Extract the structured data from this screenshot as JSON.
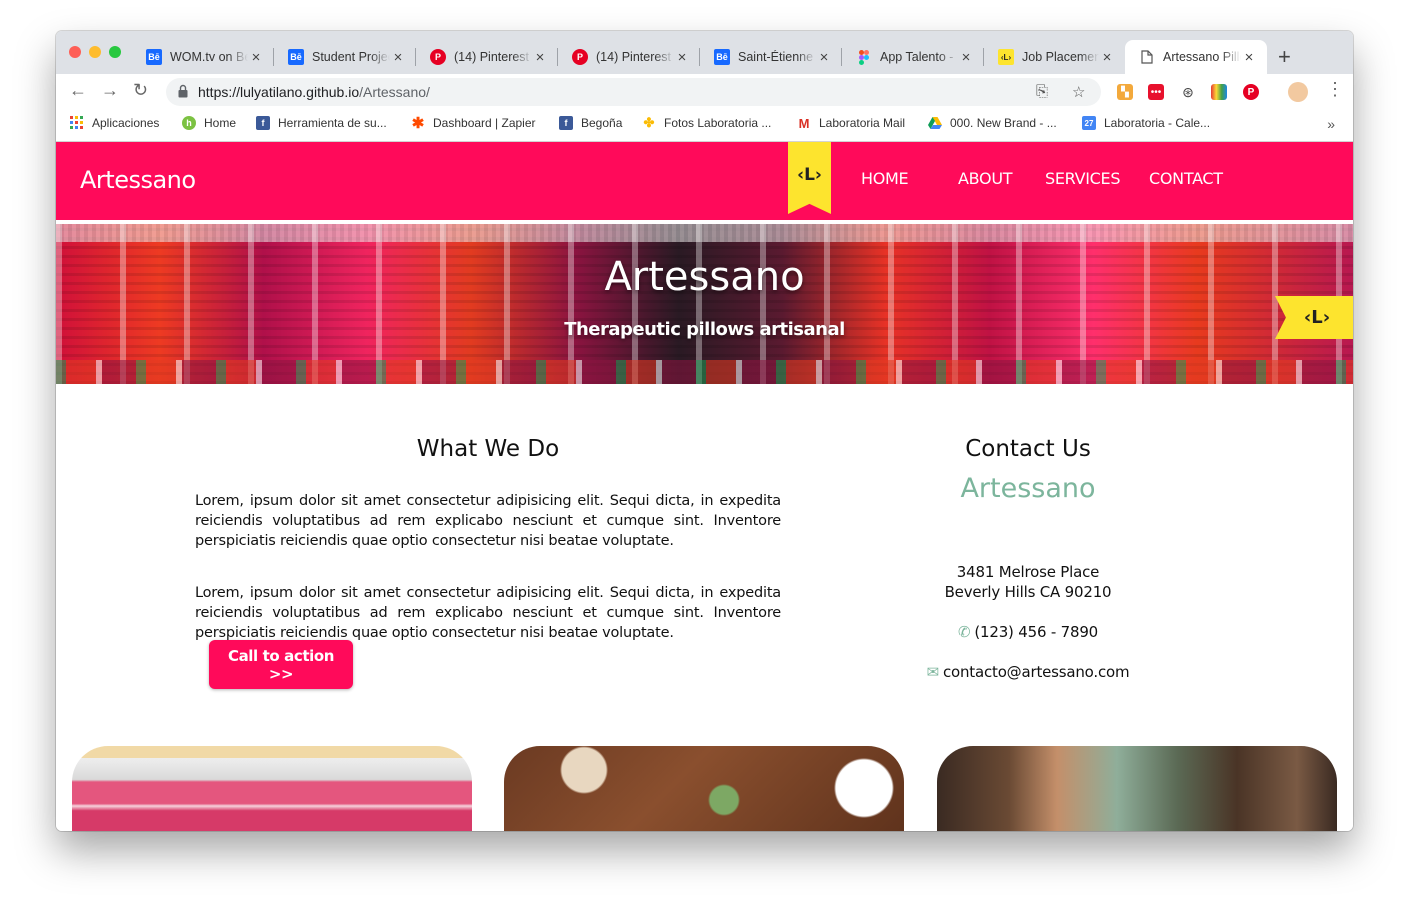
{
  "browser": {
    "tabs": [
      {
        "title": "WOM.tv on Behance",
        "icon": "behance-icon",
        "icon_text": "Bē",
        "color": "#1769ff",
        "active": false
      },
      {
        "title": "Student Projects",
        "icon": "behance-icon",
        "icon_text": "Bē",
        "color": "#1769ff",
        "active": false
      },
      {
        "title": "(14) Pinterest",
        "icon": "pinterest-icon",
        "icon_text": "P",
        "color": "#e60023",
        "active": false
      },
      {
        "title": "(14) Pinterest",
        "icon": "pinterest-icon",
        "icon_text": "P",
        "color": "#e60023",
        "active": false
      },
      {
        "title": "Saint-Étienne",
        "icon": "behance-icon",
        "icon_text": "Bē",
        "color": "#1769ff",
        "active": false
      },
      {
        "title": "App Talento -",
        "icon": "figma-icon",
        "icon_text": "",
        "color": "#f24e1e",
        "active": false
      },
      {
        "title": "Job Placement",
        "icon": "laboratoria-icon",
        "icon_text": "‹L›",
        "color": "#fde42e",
        "active": false
      },
      {
        "title": "Artessano Pillows",
        "icon": "document-icon",
        "icon_text": "",
        "color": "#ffffff",
        "active": true
      }
    ],
    "url_host": "https://lulyatilano.github.io",
    "url_path": "/Artessano/",
    "bookmarks": [
      {
        "label": "Aplicaciones",
        "icon": "apps-grid-icon",
        "color": "#4285f4"
      },
      {
        "label": "Home",
        "icon": "home-leaf-icon",
        "color": "#7cc242"
      },
      {
        "label": "Herramienta de su...",
        "icon": "facebook-icon",
        "color": "#3b5998"
      },
      {
        "label": "Dashboard | Zapier",
        "icon": "zapier-icon",
        "color": "#ff4a00"
      },
      {
        "label": "Begoña",
        "icon": "facebook-icon",
        "color": "#3b5998"
      },
      {
        "label": "Fotos Laboratoria ...",
        "icon": "photos-icon",
        "color": "#fbbc05"
      },
      {
        "label": "Laboratoria Mail",
        "icon": "gmail-icon",
        "color": "#d93025"
      },
      {
        "label": "000. New Brand - ...",
        "icon": "drive-icon",
        "color": "#0f9d58"
      },
      {
        "label": "Laboratoria - Cale...",
        "icon": "calendar-icon",
        "color": "#4285f4"
      }
    ]
  },
  "site": {
    "brand": "Artessano",
    "ribbon_text": "‹L›",
    "nav": [
      "HOME",
      "ABOUT",
      "SERVICES",
      "CONTACT"
    ],
    "hero_title": "Artessano",
    "hero_subtitle": "Therapeutic pillows artisanal",
    "flag_text": "‹L›",
    "what_we_do": {
      "title": "What We Do",
      "paragraphs": [
        "Lorem, ipsum dolor sit amet consectetur adipisicing elit. Sequi dicta, in expedita reiciendis voluptatibus ad rem explicabo nesciunt et cumque sint. Inventore perspiciatis reiciendis quae optio consectetur nisi beatae voluptate.",
        "Lorem, ipsum dolor sit amet consectetur adipisicing elit. Sequi dicta, in expedita reiciendis voluptatibus ad rem explicabo nesciunt et cumque sint. Inventore perspiciatis reiciendis quae optio consectetur nisi beatae voluptate."
      ],
      "cta": "Call to action >>"
    },
    "contact": {
      "title": "Contact Us",
      "name": "Artessano",
      "address1": "3481 Melrose Place",
      "address2": "Beverly Hills CA 90210",
      "phone": "(123) 456 - 7890",
      "email": "contacto@artessano.com"
    },
    "colors": {
      "primary": "#ff0a5a",
      "accent": "#7cb59c",
      "ribbon": "#fde42e"
    }
  }
}
